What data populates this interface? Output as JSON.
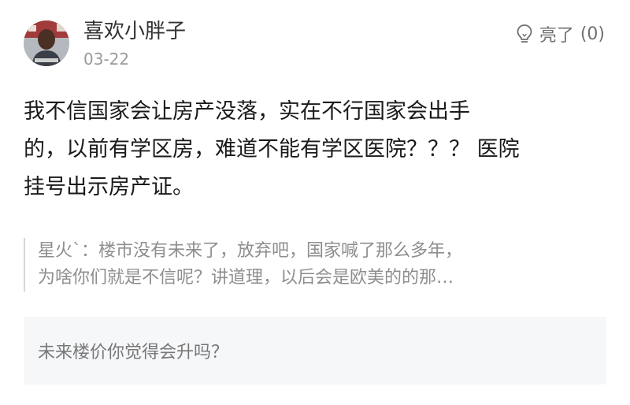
{
  "post": {
    "username": "喜欢小胖子",
    "date": "03-22",
    "like": {
      "label": "亮了",
      "count": "(0)",
      "icon": "lightbulb-icon"
    },
    "content_lines": [
      "我不信国家会让房产没落，实在不行国家会出手",
      "的，以前有学区房，难道不能有学区医院？？？ 医院",
      "挂号出示房产证。"
    ]
  },
  "quote": {
    "lines": [
      "星火`：楼市没有未来了，放弃吧，国家喊了那么多年，",
      "为啥你们就是不信呢？讲道理，以后会是欧美的的那…"
    ]
  },
  "question": {
    "text": "未来楼价你觉得会升吗？"
  }
}
